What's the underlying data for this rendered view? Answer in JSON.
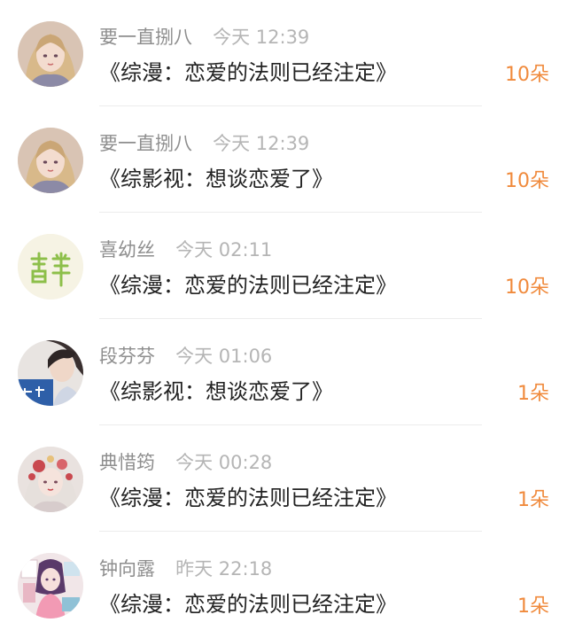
{
  "items": [
    {
      "user": "要一直捌八",
      "time": "今天 12:39",
      "title": "《综漫：恋爱的法则已经注定》",
      "count": "10朵",
      "avatar": "avatar-girl-blonde-icon"
    },
    {
      "user": "要一直捌八",
      "time": "今天 12:39",
      "title": "《综影视：想谈恋爱了》",
      "count": "10朵",
      "avatar": "avatar-girl-blonde-icon"
    },
    {
      "user": "喜幼丝",
      "time": "今天 02:11",
      "title": "《综漫：恋爱的法则已经注定》",
      "count": "10朵",
      "avatar": "avatar-green-glyph-icon"
    },
    {
      "user": "段芬芬",
      "time": "今天 01:06",
      "title": "《综影视：想谈恋爱了》",
      "count": "1朵",
      "avatar": "avatar-portrait-icon"
    },
    {
      "user": "典惜筠",
      "time": "今天 00:28",
      "title": "《综漫：恋爱的法则已经注定》",
      "count": "1朵",
      "avatar": "avatar-flower-girl-icon"
    },
    {
      "user": "钟向露",
      "time": "昨天 22:18",
      "title": "《综漫：恋爱的法则已经注定》",
      "count": "1朵",
      "avatar": "avatar-anime-room-icon"
    }
  ],
  "colors": {
    "count": "#f08a3c",
    "user": "#8e8e8e",
    "time": "#b5b5b5",
    "title": "#222222",
    "divider": "#ececec"
  }
}
